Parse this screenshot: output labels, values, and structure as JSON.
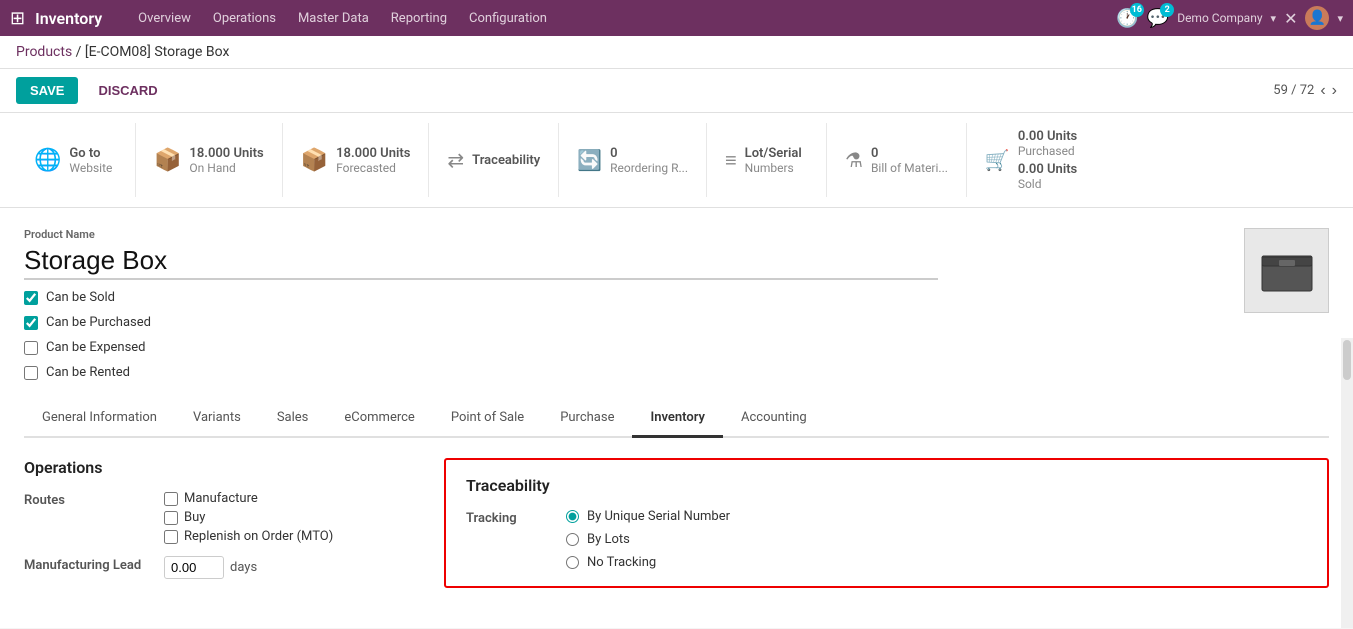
{
  "nav": {
    "app_title": "Inventory",
    "items": [
      "Overview",
      "Operations",
      "Master Data",
      "Reporting",
      "Configuration"
    ],
    "company": "Demo Company",
    "badge_clock": "16",
    "badge_chat": "2",
    "pagination": "59 / 72"
  },
  "breadcrumb": {
    "link": "Products",
    "separator": "/",
    "current": "[E-COM08] Storage Box"
  },
  "toolbar": {
    "save": "SAVE",
    "discard": "DISCARD"
  },
  "smart_buttons": [
    {
      "icon": "🌐",
      "value": "Go to",
      "label": "Website",
      "globe": true
    },
    {
      "icon": "📦",
      "value": "18.000 Units",
      "label": "On Hand"
    },
    {
      "icon": "📦",
      "value": "18.000 Units",
      "label": "Forecasted"
    },
    {
      "icon": "↔",
      "value": "Traceability",
      "label": ""
    },
    {
      "icon": "🔄",
      "value": "0",
      "label": "Reordering R..."
    },
    {
      "icon": "≡",
      "value": "Lot/Serial",
      "label": "Numbers"
    },
    {
      "icon": "⚗",
      "value": "0",
      "label": "Bill of Materi..."
    },
    {
      "icon": "🛒",
      "value": "0.00 Units",
      "label": "Purchased"
    },
    {
      "icon": "📊",
      "value": "0.00 Units",
      "label": "Sold"
    }
  ],
  "product": {
    "name_label": "Product Name",
    "name": "Storage Box",
    "checkboxes": [
      {
        "label": "Can be Sold",
        "checked": true
      },
      {
        "label": "Can be Purchased",
        "checked": true
      },
      {
        "label": "Can be Expensed",
        "checked": false
      },
      {
        "label": "Can be Rented",
        "checked": false
      }
    ]
  },
  "tabs": [
    {
      "label": "General Information",
      "active": false
    },
    {
      "label": "Variants",
      "active": false
    },
    {
      "label": "Sales",
      "active": false
    },
    {
      "label": "eCommerce",
      "active": false
    },
    {
      "label": "Point of Sale",
      "active": false
    },
    {
      "label": "Purchase",
      "active": false
    },
    {
      "label": "Inventory",
      "active": true
    },
    {
      "label": "Accounting",
      "active": false
    }
  ],
  "operations": {
    "title": "Operations",
    "routes_label": "Routes",
    "routes": [
      {
        "label": "Manufacture",
        "checked": false
      },
      {
        "label": "Buy",
        "checked": false
      },
      {
        "label": "Replenish on Order (MTO)",
        "checked": false
      }
    ],
    "mfg_lead_label": "Manufacturing Lead",
    "mfg_lead_value": "0.00",
    "mfg_lead_unit": "days"
  },
  "traceability": {
    "title": "Traceability",
    "tracking_label": "Tracking",
    "options": [
      {
        "label": "By Unique Serial Number",
        "selected": true
      },
      {
        "label": "By Lots",
        "selected": false
      },
      {
        "label": "No Tracking",
        "selected": false
      }
    ]
  }
}
